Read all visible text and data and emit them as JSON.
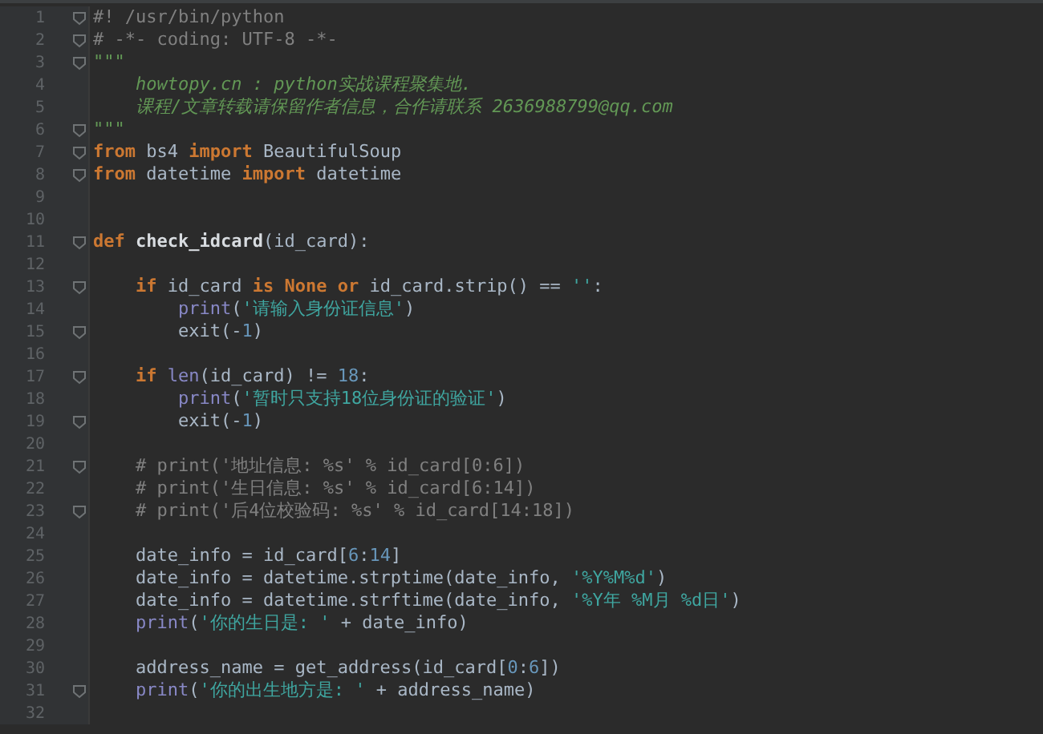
{
  "editor": {
    "lines": [
      {
        "number": "1",
        "fold": true,
        "tokens": [
          {
            "kind": "comment",
            "text": "#! /usr/bin/python"
          }
        ]
      },
      {
        "number": "2",
        "fold": true,
        "tokens": [
          {
            "kind": "comment",
            "text": "# -*- coding: UTF-8 -*-"
          }
        ]
      },
      {
        "number": "3",
        "fold": true,
        "tokens": [
          {
            "kind": "doc",
            "text": "\"\"\""
          }
        ]
      },
      {
        "number": "4",
        "fold": false,
        "tokens": [
          {
            "kind": "doc",
            "text": "    howtopy.cn : python实战课程聚集地."
          }
        ]
      },
      {
        "number": "5",
        "fold": false,
        "tokens": [
          {
            "kind": "doc",
            "text": "    课程/文章转载请保留作者信息，合作请联系 2636988799@qq.com"
          }
        ]
      },
      {
        "number": "6",
        "fold": true,
        "tokens": [
          {
            "kind": "doc",
            "text": "\"\"\""
          }
        ]
      },
      {
        "number": "7",
        "fold": true,
        "tokens": [
          {
            "kind": "keyword",
            "text": "from"
          },
          {
            "kind": "plain",
            "text": " bs4 "
          },
          {
            "kind": "keyword",
            "text": "import"
          },
          {
            "kind": "plain",
            "text": " BeautifulSoup"
          }
        ]
      },
      {
        "number": "8",
        "fold": true,
        "tokens": [
          {
            "kind": "keyword",
            "text": "from"
          },
          {
            "kind": "plain",
            "text": " datetime "
          },
          {
            "kind": "keyword",
            "text": "import"
          },
          {
            "kind": "plain",
            "text": " datetime"
          }
        ]
      },
      {
        "number": "9",
        "fold": false
      },
      {
        "number": "10",
        "fold": false
      },
      {
        "number": "11",
        "fold": true,
        "tokens": [
          {
            "kind": "keyword",
            "text": "def"
          },
          {
            "kind": "defname",
            "text": " check_idcard"
          },
          {
            "kind": "plain",
            "text": "(id_card):"
          }
        ]
      },
      {
        "number": "12",
        "fold": false
      },
      {
        "number": "13",
        "fold": true,
        "tokens": [
          {
            "kind": "keyword",
            "text": "    if"
          },
          {
            "kind": "plain",
            "text": " id_card "
          },
          {
            "kind": "keyword",
            "text": "is None or"
          },
          {
            "kind": "plain",
            "text": " id_card.strip() == "
          },
          {
            "kind": "string",
            "text": "''"
          },
          {
            "kind": "plain",
            "text": ":"
          }
        ]
      },
      {
        "number": "14",
        "fold": false,
        "tokens": [
          {
            "kind": "builtin",
            "text": "        print"
          },
          {
            "kind": "plain",
            "text": "("
          },
          {
            "kind": "string",
            "text": "'请输入身份证信息'"
          },
          {
            "kind": "plain",
            "text": ")"
          }
        ]
      },
      {
        "number": "15",
        "fold": true,
        "tokens": [
          {
            "kind": "plain",
            "text": "        exit(-"
          },
          {
            "kind": "number",
            "text": "1"
          },
          {
            "kind": "plain",
            "text": ")"
          }
        ]
      },
      {
        "number": "16",
        "fold": false
      },
      {
        "number": "17",
        "fold": true,
        "tokens": [
          {
            "kind": "keyword",
            "text": "    if"
          },
          {
            "kind": "builtin",
            "text": " len"
          },
          {
            "kind": "plain",
            "text": "(id_card) != "
          },
          {
            "kind": "number",
            "text": "18"
          },
          {
            "kind": "plain",
            "text": ":"
          }
        ]
      },
      {
        "number": "18",
        "fold": false,
        "tokens": [
          {
            "kind": "builtin",
            "text": "        print"
          },
          {
            "kind": "plain",
            "text": "("
          },
          {
            "kind": "string",
            "text": "'暂时只支持18位身份证的验证'"
          },
          {
            "kind": "plain",
            "text": ")"
          }
        ]
      },
      {
        "number": "19",
        "fold": true,
        "tokens": [
          {
            "kind": "plain",
            "text": "        exit(-"
          },
          {
            "kind": "number",
            "text": "1"
          },
          {
            "kind": "plain",
            "text": ")"
          }
        ]
      },
      {
        "number": "20",
        "fold": false
      },
      {
        "number": "21",
        "fold": true,
        "tokens": [
          {
            "kind": "comment",
            "text": "    # print('地址信息: %s' % id_card[0:6])"
          }
        ]
      },
      {
        "number": "22",
        "fold": false,
        "tokens": [
          {
            "kind": "comment",
            "text": "    # print('生日信息: %s' % id_card[6:14])"
          }
        ]
      },
      {
        "number": "23",
        "fold": true,
        "tokens": [
          {
            "kind": "comment",
            "text": "    # print('后4位校验码: %s' % id_card[14:18])"
          }
        ]
      },
      {
        "number": "24",
        "fold": false
      },
      {
        "number": "25",
        "fold": false,
        "tokens": [
          {
            "kind": "plain",
            "text": "    date_info = id_card["
          },
          {
            "kind": "number",
            "text": "6"
          },
          {
            "kind": "plain",
            "text": ":"
          },
          {
            "kind": "number",
            "text": "14"
          },
          {
            "kind": "plain",
            "text": "]"
          }
        ]
      },
      {
        "number": "26",
        "fold": false,
        "tokens": [
          {
            "kind": "plain",
            "text": "    date_info = datetime.strptime(date_info, "
          },
          {
            "kind": "string",
            "text": "'%Y%M%d'"
          },
          {
            "kind": "plain",
            "text": ")"
          }
        ]
      },
      {
        "number": "27",
        "fold": false,
        "tokens": [
          {
            "kind": "plain",
            "text": "    date_info = datetime.strftime(date_info, "
          },
          {
            "kind": "string",
            "text": "'%Y年 %M月 %d日'"
          },
          {
            "kind": "plain",
            "text": ")"
          }
        ]
      },
      {
        "number": "28",
        "fold": false,
        "tokens": [
          {
            "kind": "builtin",
            "text": "    print"
          },
          {
            "kind": "plain",
            "text": "("
          },
          {
            "kind": "string",
            "text": "'你的生日是: '"
          },
          {
            "kind": "plain",
            "text": " + date_info)"
          }
        ]
      },
      {
        "number": "29",
        "fold": false
      },
      {
        "number": "30",
        "fold": false,
        "tokens": [
          {
            "kind": "plain",
            "text": "    address_name = get_address(id_card["
          },
          {
            "kind": "number",
            "text": "0"
          },
          {
            "kind": "plain",
            "text": ":"
          },
          {
            "kind": "number",
            "text": "6"
          },
          {
            "kind": "plain",
            "text": "])"
          }
        ]
      },
      {
        "number": "31",
        "fold": true,
        "tokens": [
          {
            "kind": "builtin",
            "text": "    print"
          },
          {
            "kind": "plain",
            "text": "("
          },
          {
            "kind": "string",
            "text": "'你的出生地方是: '"
          },
          {
            "kind": "plain",
            "text": " + address_name)"
          }
        ]
      },
      {
        "number": "32",
        "fold": false
      }
    ]
  }
}
